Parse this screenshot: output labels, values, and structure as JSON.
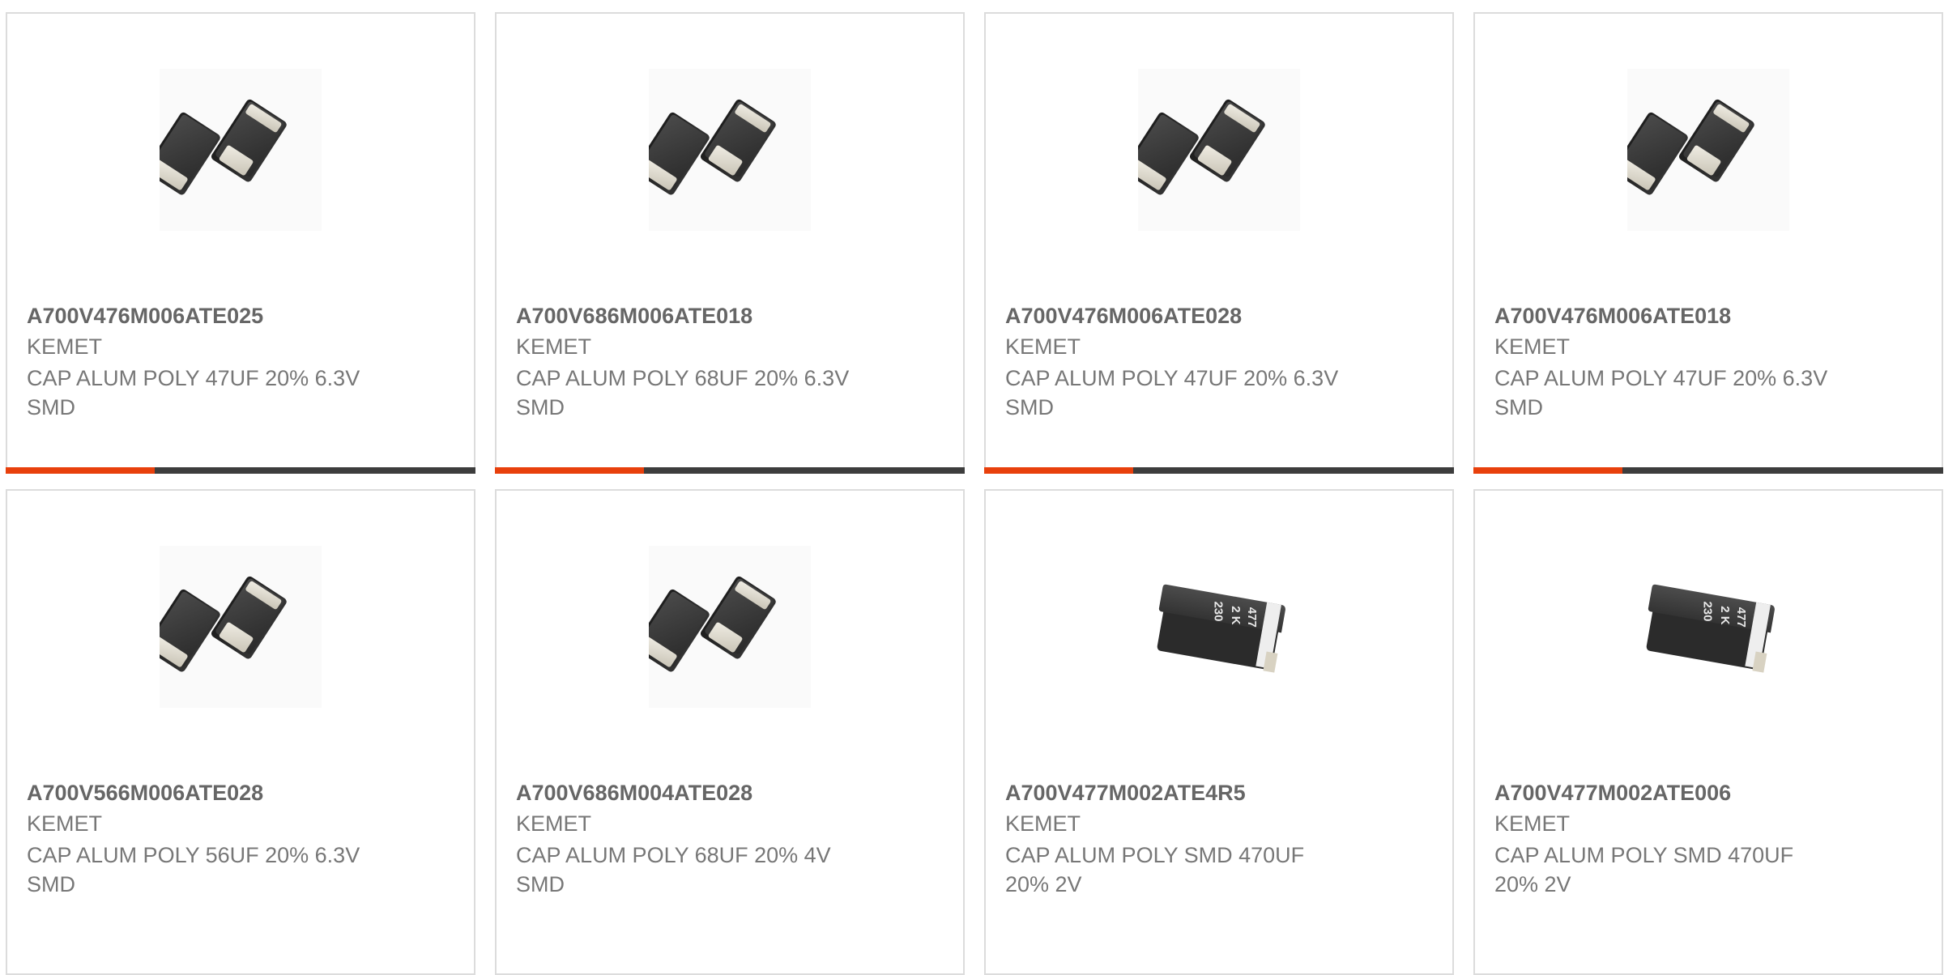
{
  "products": [
    {
      "part_number": "A700V476M006ATE025",
      "manufacturer": "KEMET",
      "description": "CAP ALUM POLY 47UF 20% 6.3V SMD",
      "image_icon": "smd-capacitor-pair-icon"
    },
    {
      "part_number": "A700V686M006ATE018",
      "manufacturer": "KEMET",
      "description": "CAP ALUM POLY 68UF 20% 6.3V SMD",
      "image_icon": "smd-capacitor-pair-icon"
    },
    {
      "part_number": "A700V476M006ATE028",
      "manufacturer": "KEMET",
      "description": "CAP ALUM POLY 47UF 20% 6.3V SMD",
      "image_icon": "smd-capacitor-pair-icon"
    },
    {
      "part_number": "A700V476M006ATE018",
      "manufacturer": "KEMET",
      "description": "CAP ALUM POLY 47UF 20% 6.3V SMD",
      "image_icon": "smd-capacitor-pair-icon"
    },
    {
      "part_number": "A700V566M006ATE028",
      "manufacturer": "KEMET",
      "description": "CAP ALUM POLY 56UF 20% 6.3V SMD",
      "image_icon": "smd-capacitor-pair-icon"
    },
    {
      "part_number": "A700V686M004ATE028",
      "manufacturer": "KEMET",
      "description": "CAP ALUM POLY 68UF 20% 4V SMD",
      "image_icon": "smd-capacitor-pair-icon"
    },
    {
      "part_number": "A700V477M002ATE4R5",
      "manufacturer": "KEMET",
      "description": "CAP ALUM POLY SMD 470UF 20% 2V",
      "image_icon": "smd-capacitor-single-icon",
      "component_marking": [
        "477",
        "2 K",
        "230"
      ]
    },
    {
      "part_number": "A700V477M002ATE006",
      "manufacturer": "KEMET",
      "description": "CAP ALUM POLY SMD 470UF 20% 2V",
      "image_icon": "smd-capacitor-single-icon",
      "component_marking": [
        "477",
        "2 K",
        "230"
      ]
    }
  ],
  "colors": {
    "accent": "#e8400c",
    "bar_dark": "#3d3d3d",
    "card_border": "#dcdcdc",
    "text": "#666666"
  }
}
